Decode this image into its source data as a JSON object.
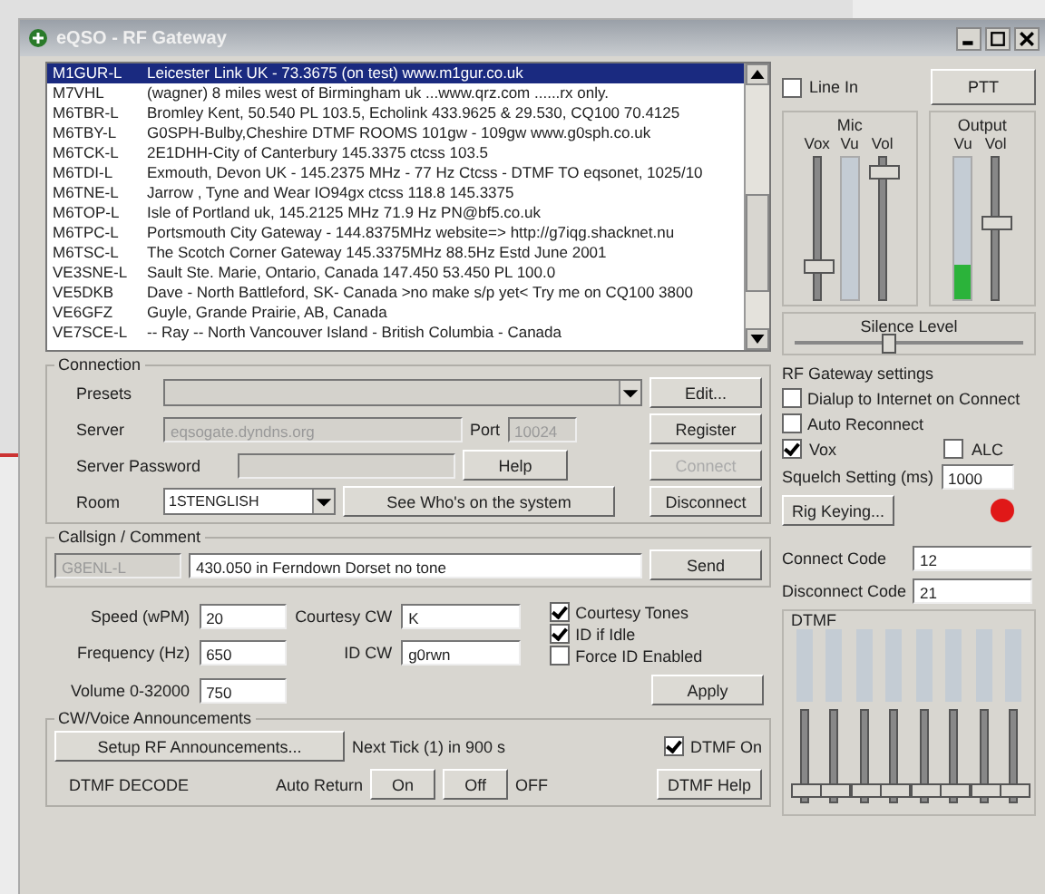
{
  "window": {
    "title": "eQSO - RF Gateway"
  },
  "stations": [
    {
      "callsign": "M1GUR-L",
      "description": "Leicester Link UK - 73.3675 (on test) www.m1gur.co.uk",
      "selected": true
    },
    {
      "callsign": "M7VHL",
      "description": "(wagner) 8 miles west of Birmingham uk ...www.qrz.com ......rx only.",
      "selected": false
    },
    {
      "callsign": "M6TBR-L",
      "description": "Bromley Kent, 50.540 PL 103.5, Echolink 433.9625 & 29.530, CQ100 70.4125",
      "selected": false
    },
    {
      "callsign": "M6TBY-L",
      "description": "G0SPH-Bulby,Cheshire DTMF ROOMS 101gw - 109gw www.g0sph.co.uk",
      "selected": false
    },
    {
      "callsign": "M6TCK-L",
      "description": "2E1DHH-City of Canterbury 145.3375  ctcss 103.5",
      "selected": false
    },
    {
      "callsign": "M6TDI-L",
      "description": "Exmouth, Devon UK - 145.2375 MHz - 77 Hz Ctcss - DTMF TO eqsonet, 1025/10",
      "selected": false
    },
    {
      "callsign": "M6TNE-L",
      "description": "Jarrow , Tyne and Wear IO94gx ctcss 118.8 145.3375",
      "selected": false
    },
    {
      "callsign": "M6TOP-L",
      "description": "Isle of Portland uk, 145.2125 MHz 71.9 Hz    PN@bf5.co.uk",
      "selected": false
    },
    {
      "callsign": "M6TPC-L",
      "description": "Portsmouth City Gateway - 144.8375MHz website=> http://g7iqg.shacknet.nu",
      "selected": false
    },
    {
      "callsign": "M6TSC-L",
      "description": "The Scotch Corner Gateway 145.3375MHz 88.5Hz Estd June 2001",
      "selected": false
    },
    {
      "callsign": "VE3SNE-L",
      "description": "Sault Ste. Marie, Ontario, Canada  147.450 53.450 PL 100.0",
      "selected": false
    },
    {
      "callsign": "VE5DKB",
      "description": "Dave - North Battleford, SK- Canada >no make s/p yet< Try me on CQ100 3800",
      "selected": false
    },
    {
      "callsign": "VE6GFZ",
      "description": "Guyle, Grande Prairie, AB, Canada",
      "selected": false
    },
    {
      "callsign": "VE7SCE-L",
      "description": "-- Ray -- North Vancouver Island - British Columbia - Canada",
      "selected": false
    }
  ],
  "audio": {
    "line_in": {
      "label": "Line In",
      "checked": false
    },
    "ptt": "PTT",
    "mic": {
      "title": "Mic",
      "sliders": [
        {
          "label": "Vox",
          "kind": "slider",
          "level": 0.2
        },
        {
          "label": "Vu",
          "kind": "meter"
        },
        {
          "label": "Vol",
          "kind": "slider",
          "level": 0.95
        }
      ]
    },
    "output": {
      "title": "Output",
      "sliders": [
        {
          "label": "Vu",
          "kind": "meter",
          "level": 0.25
        },
        {
          "label": "Vol",
          "kind": "slider",
          "level": 0.55
        }
      ]
    },
    "silence": {
      "label": "Silence Level",
      "level": 0.4
    }
  },
  "rf_gateway": {
    "title": "RF Gateway settings",
    "checks": [
      {
        "label": "Dialup to Internet on Connect",
        "checked": false
      },
      {
        "label": "Auto Reconnect",
        "checked": false
      }
    ],
    "vox": {
      "label": "Vox",
      "checked": true
    },
    "alc": {
      "label": "ALC",
      "checked": false
    },
    "squelch": {
      "label": "Squelch Setting (ms)",
      "value": "1000"
    },
    "rig_keying": "Rig Keying...",
    "keyed": true,
    "connect_code": {
      "label": "Connect Code",
      "value": "12"
    },
    "disconnect_code": {
      "label": "Disconnect Code",
      "value": "21"
    },
    "dtmf": {
      "title": "DTMF",
      "channels": [
        {
          "level": 0.05
        },
        {
          "level": 0.05
        },
        {
          "level": 0.05
        },
        {
          "level": 0.05
        },
        {
          "level": 0.05
        },
        {
          "level": 0.05
        },
        {
          "level": 0.05
        },
        {
          "level": 0.05
        }
      ]
    }
  },
  "connection": {
    "title": "Connection",
    "presets_label": "Presets",
    "edit": "Edit...",
    "server_label": "Server",
    "server": "eqsogate.dyndns.org",
    "port_label": "Port",
    "port": "10024",
    "register": "Register",
    "password_label": "Server Password",
    "help": "Help",
    "connect": {
      "label": "Connect",
      "disabled": true
    },
    "room_label": "Room",
    "room": "1STENGLISH",
    "see_who": "See Who's on the system",
    "disconnect": "Disconnect"
  },
  "callsign": {
    "title": "Callsign / Comment",
    "callsign": "G8ENL-L",
    "comment": "430.050 in Ferndown Dorset no tone",
    "send": "Send"
  },
  "cw": {
    "speed": {
      "label": "Speed (wPM)",
      "value": "20"
    },
    "frequency": {
      "label": "Frequency (Hz)",
      "value": "650"
    },
    "volume": {
      "label": "Volume 0-32000",
      "value": "750"
    },
    "courtesy": {
      "label": "Courtesy CW",
      "value": "K"
    },
    "id": {
      "label": "ID CW",
      "value": "g0rwn"
    },
    "options": [
      {
        "label": "Courtesy Tones",
        "checked": true
      },
      {
        "label": "ID if Idle",
        "checked": true
      },
      {
        "label": "Force ID Enabled",
        "checked": false
      }
    ],
    "apply": "Apply"
  },
  "announcements": {
    "title": "CW/Voice Announcements",
    "setup": "Setup RF Announcements...",
    "next_tick": "Next Tick (1) in 900 s",
    "dtmf_on": {
      "label": "DTMF On",
      "checked": true
    },
    "dtmf_decode": "DTMF DECODE",
    "auto_return": "Auto Return",
    "on": "On",
    "off": "Off",
    "state": "OFF",
    "dtmf_help": "DTMF Help"
  }
}
